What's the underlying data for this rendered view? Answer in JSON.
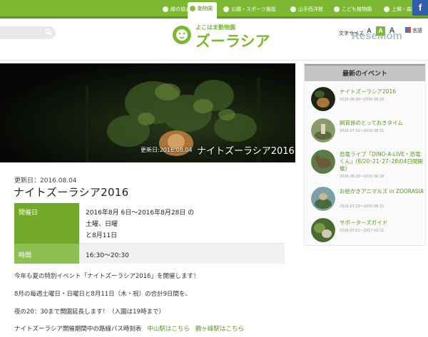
{
  "nav": {
    "tabs": [
      {
        "label": "緑の協会",
        "active": false
      },
      {
        "label": "動物園",
        "active": true
      },
      {
        "label": "公園・スポーツ施設",
        "active": false
      },
      {
        "label": "山手西洋館",
        "active": false
      },
      {
        "label": "こども植物園",
        "active": false
      },
      {
        "label": "上郷・森の家",
        "active": false
      }
    ],
    "facebook": "f"
  },
  "header": {
    "logo_sub": "よこはま動物園",
    "logo_main": "ズーラシア",
    "font_size_label": "文字サイズ",
    "font_sizes": [
      "A",
      "A",
      "A"
    ],
    "language": "言語",
    "watermark": "ReseMom"
  },
  "hero": {
    "date": "更新日:2016.08.04",
    "title": "ナイトズーラシア2016"
  },
  "article": {
    "updated": "更新日：2016.08.04",
    "title": "ナイトズーラシア2016",
    "table": {
      "period_label": "開催日",
      "period_lines": [
        "2016年8月 6日～2016年8月28日 の",
        "土曜、日曜",
        "と8月11日"
      ],
      "time_label": "時間",
      "time_value": "16:30～20:30"
    },
    "paragraphs": [
      "今年も夏の特別イベント「ナイトズーラシア2016」を開催します！",
      "8月の毎週土曜日・日曜日と8月11日（木・祝）の合計9日間を、",
      "夜の20：30まで開園延長します！（入園は19時まで）"
    ],
    "bus_text": "ナイトズーラシア開催期間中の路線バス時刻表",
    "bus_links": [
      "中山駅はこちら",
      "鶴ヶ峰駅はこちら"
    ]
  },
  "sidebar": {
    "heading": "最新のイベント",
    "events": [
      {
        "title": "ナイトズーラシア2016",
        "date": "2016.08.06～2016.08.28"
      },
      {
        "title": "飼育係のとっておきタイム",
        "date": "2016.07.01～2016.08.31"
      },
      {
        "title": "恐竜ライブ「DINO-A-LIVE・恐竜くん」(8/20･21･27･28の4日間開催)",
        "date": "2016.08.20～2016.08.28"
      },
      {
        "title": "お絵かきアニマルズ in ZOORASIA",
        "date": "2016.07.23～2016.08.31"
      },
      {
        "title": "サポーターズガイド",
        "date": "2016.07.01～2017.03.31"
      }
    ]
  },
  "colors": {
    "accent": "#7cb832",
    "table_label": "#73a92a",
    "link": "#5c9a1e"
  }
}
